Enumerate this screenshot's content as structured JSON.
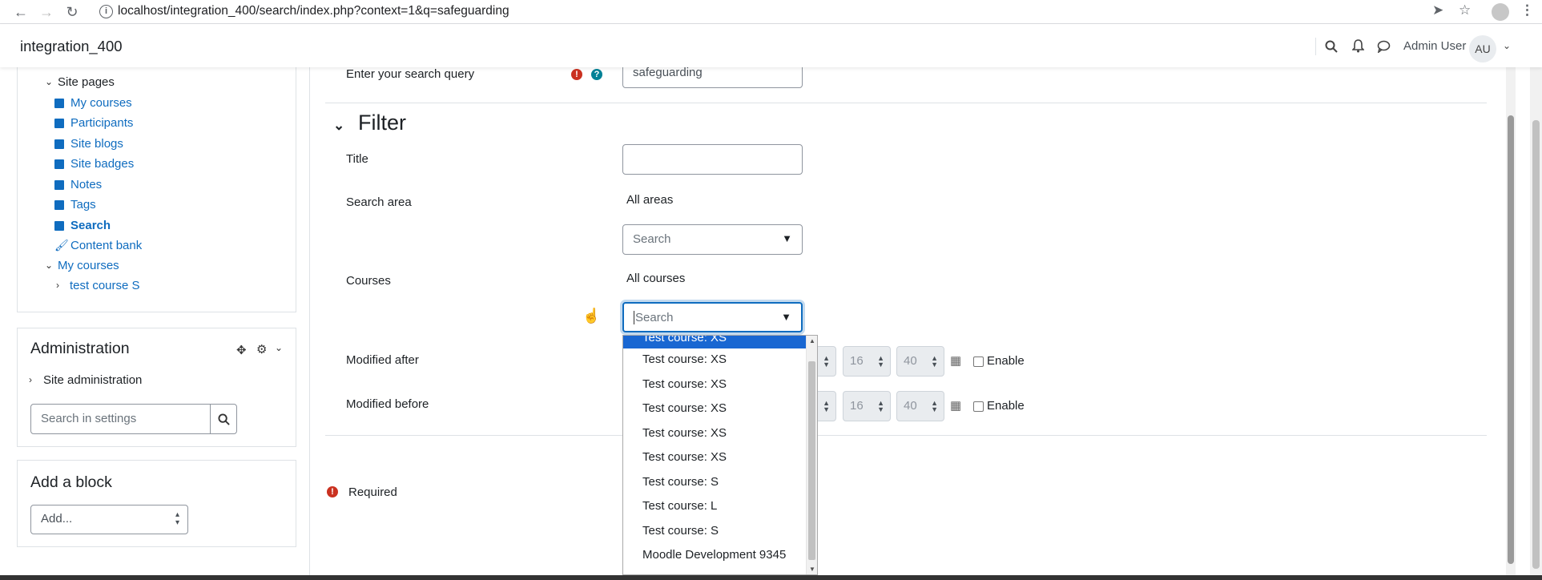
{
  "browser": {
    "url": "localhost/integration_400/search/index.php?context=1&q=safeguarding"
  },
  "navbar": {
    "site_name": "integration_400",
    "user_name": "Admin User",
    "avatar_initials": "AU"
  },
  "sidebar": {
    "site_pages_label": "Site pages",
    "items": [
      {
        "label": "My courses"
      },
      {
        "label": "Participants"
      },
      {
        "label": "Site blogs"
      },
      {
        "label": "Site badges"
      },
      {
        "label": "Notes"
      },
      {
        "label": "Tags"
      },
      {
        "label": "Search"
      },
      {
        "label": "Content bank"
      }
    ],
    "my_courses_label": "My courses",
    "course_item": "test course S"
  },
  "administration": {
    "title": "Administration",
    "site_admin": "Site administration",
    "search_placeholder": "Search in settings"
  },
  "add_block": {
    "title": "Add a block",
    "select_value": "Add..."
  },
  "form": {
    "query_label": "Enter your search query",
    "query_value": "safeguarding",
    "filter_title": "Filter",
    "title_label": "Title",
    "title_value": "",
    "search_area_label": "Search area",
    "search_area_value": "All areas",
    "search_area_placeholder": "Search",
    "courses_label": "Courses",
    "courses_value": "All courses",
    "courses_placeholder": "Search",
    "modified_after_label": "Modified after",
    "modified_before_label": "Modified before",
    "hour_value": "16",
    "minute_value": "40",
    "enable_label": "Enable",
    "required_label": "Required"
  },
  "courses_dropdown": {
    "selected": "Test course: XS",
    "options": [
      "Test course: XS",
      "Test course: XS",
      "Test course: XS",
      "Test course: XS",
      "Test course: XS",
      "Test course: S",
      "Test course: L",
      "Test course: S",
      "Moodle Development 9345"
    ]
  },
  "colors": {
    "link": "#0f6cbf",
    "error": "#ca3120",
    "help": "#008196",
    "selected": "#1967d2"
  }
}
